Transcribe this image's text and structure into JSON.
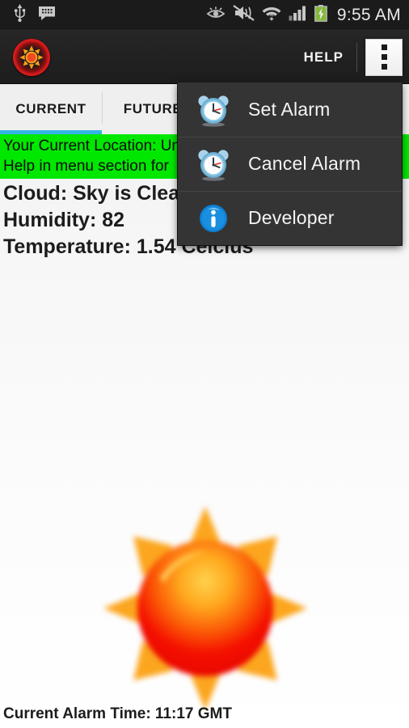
{
  "status_bar": {
    "left_icons": [
      "usb-icon",
      "message-icon"
    ],
    "right_icons": [
      "smart-stay-eye-icon",
      "sound-muted-vibrate-icon",
      "wifi-icon",
      "signal-bars-icon",
      "battery-charging-icon"
    ],
    "clock": "9:55 AM"
  },
  "action_bar": {
    "logo": "sun-app-logo-icon",
    "help_label": "HELP",
    "overflow_label": "overflow-menu-icon"
  },
  "tabs": [
    {
      "label": "CURRENT",
      "selected": true
    },
    {
      "label": "FUTURE",
      "selected": false
    }
  ],
  "banner": {
    "line1": "Your Current Location: Un",
    "line2": "Help in menu section for "
  },
  "weather": {
    "cloud": "Cloud: Sky is Clea",
    "humidity": "Humidity: 82",
    "temperature": "Temperature: 1.54 Celcius",
    "icon": "sun-weather-icon"
  },
  "footer": {
    "alarm_time": "Current Alarm Time: 11:17 GMT"
  },
  "overflow_menu": {
    "items": [
      {
        "label": "Set Alarm",
        "icon": "alarm-clock-icon"
      },
      {
        "label": "Cancel Alarm",
        "icon": "alarm-clock-icon"
      },
      {
        "label": "Developer",
        "icon": "info-icon"
      }
    ]
  },
  "colors": {
    "accent_tab": "#33b5e5",
    "banner_green": "#00e800",
    "status_bar": "#1b1b1b",
    "action_bar": "#262626",
    "menu_bg": "#343434",
    "sun_red": "#f01000",
    "sun_orange": "#ffa21e"
  }
}
